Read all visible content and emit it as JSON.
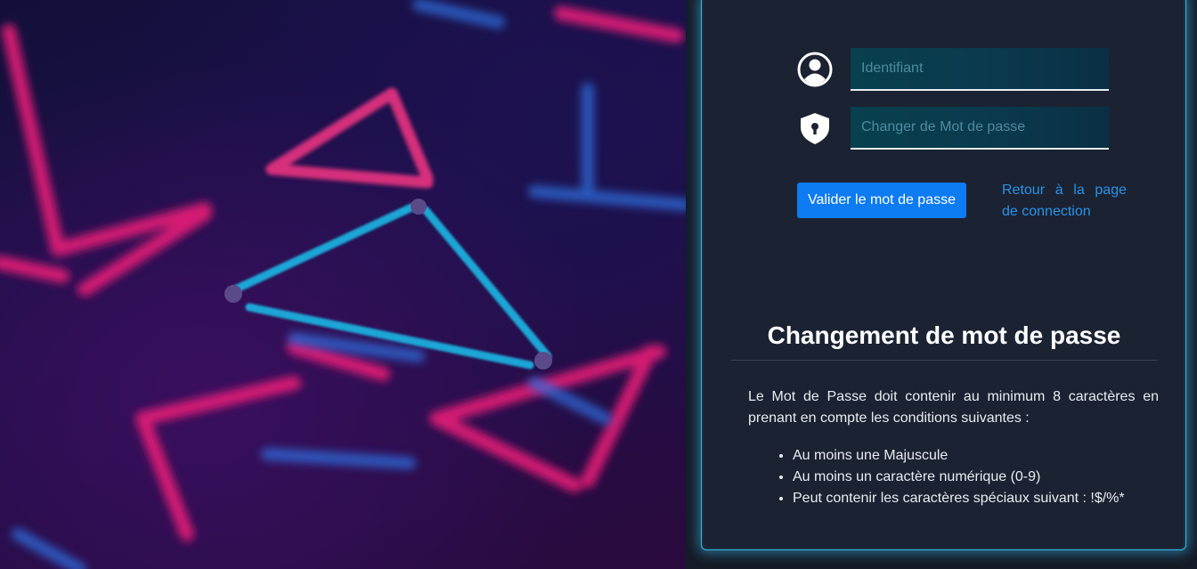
{
  "form": {
    "username_placeholder": "Identifiant",
    "password_placeholder": "Changer de Mot de passe",
    "validate_label": "Valider le mot de passe",
    "back_link_label": "Retour à la page de connection"
  },
  "info": {
    "title": "Changement de mot de passe",
    "description": "Le Mot de Passe doit contenir au minimum 8 caractères en prenant en compte les conditions suivantes :",
    "rules": [
      "Au moins une Majuscule",
      "Au moins un caractère numérique (0-9)",
      "Peut contenir les caractères spéciaux suivant : !$/%*"
    ]
  },
  "icons": {
    "user": "user-circle-icon",
    "password": "shield-lock-icon"
  },
  "colors": {
    "accent": "#0d7bf2",
    "link": "#2a93e8",
    "glow": "#3ab8e6",
    "card_bg": "#1b2232"
  }
}
